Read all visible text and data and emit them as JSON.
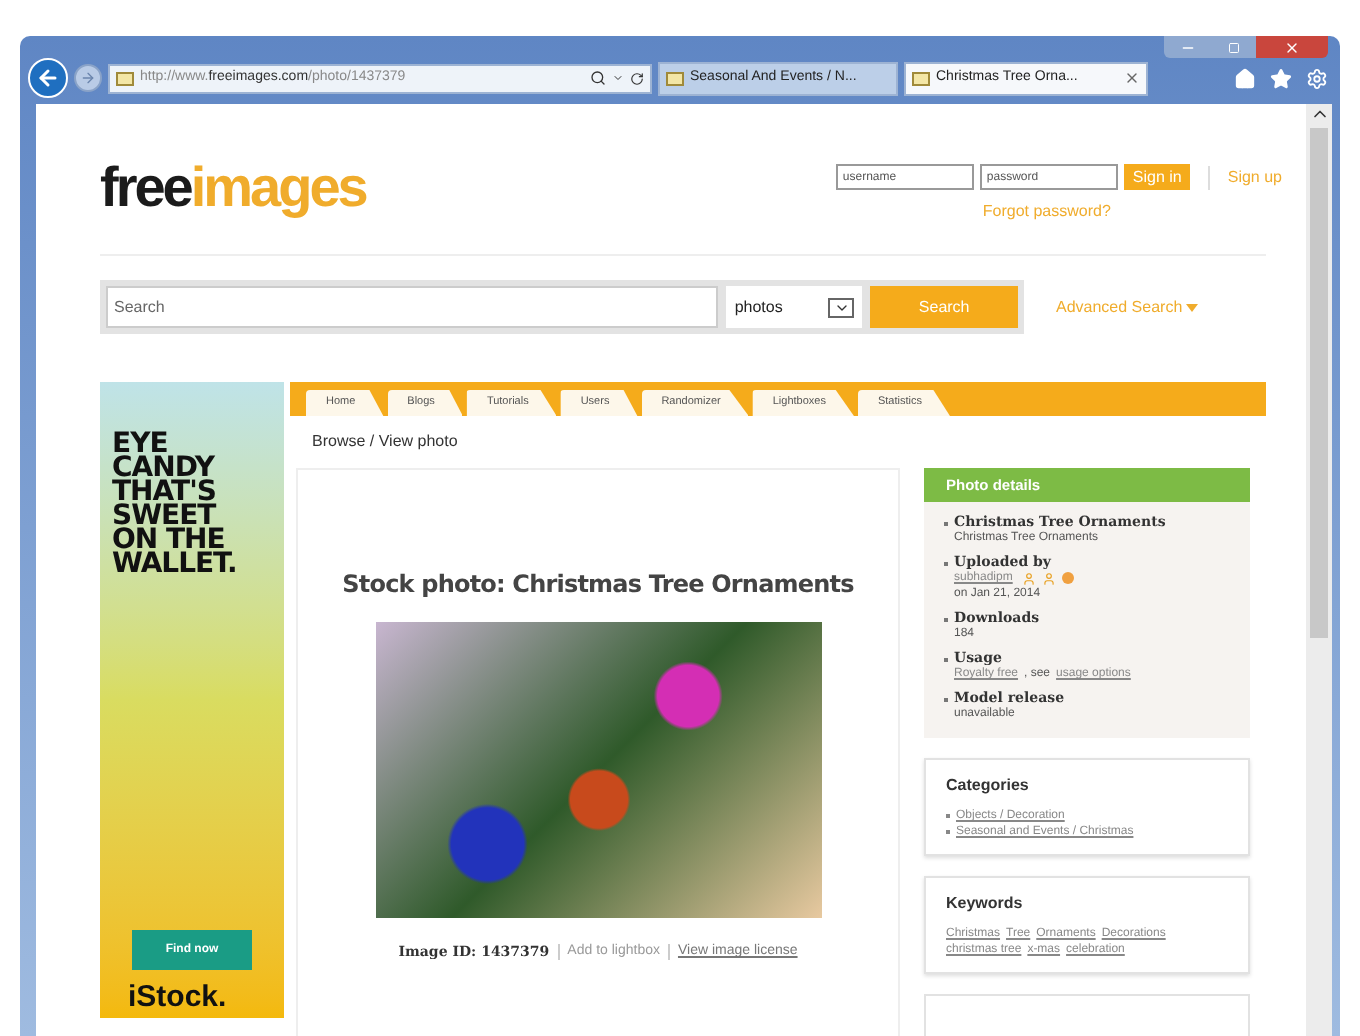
{
  "browser": {
    "address": {
      "prefix": "http://www.",
      "domain": "freeimages.com",
      "path": "/photo/1437379"
    },
    "tabs": [
      {
        "label": "Seasonal And Events / N...",
        "selected": false
      },
      {
        "label": "Christmas Tree Orna...",
        "selected": true
      }
    ]
  },
  "header": {
    "logo": {
      "first": "free",
      "second": "images"
    },
    "login": {
      "username_placeholder": "username",
      "password_placeholder": "password",
      "sign_in": "Sign in",
      "sign_up": "Sign up",
      "forgot": "Forgot password?"
    }
  },
  "search": {
    "placeholder": "Search",
    "type": "photos",
    "button": "Search",
    "advanced": "Advanced Search"
  },
  "ad": {
    "headline": [
      "EYE",
      "CANDY",
      "THAT'S",
      "SWEET",
      "ON THE",
      "WALLET."
    ],
    "button": "Find now",
    "brand": "iStock."
  },
  "nav": [
    "Home",
    "Blogs",
    "Tutorials",
    "Users",
    "Randomizer",
    "Lightboxes",
    "Statistics"
  ],
  "breadcrumb": "Browse / View photo",
  "photo": {
    "title": "Stock photo: Christmas Tree Ornaments",
    "image_id": "Image ID: 1437379",
    "actions": [
      {
        "label": "Add to lightbox",
        "kind": "plain"
      },
      {
        "label": "View image license",
        "kind": "link"
      }
    ]
  },
  "details": {
    "title": "Photo details",
    "items": [
      {
        "title": "Christmas Tree Ornaments",
        "kind": "plain",
        "lines": [
          [
            {
              "text": "Christmas Tree Ornaments",
              "kind": "plain"
            }
          ]
        ]
      },
      {
        "title": "Uploaded by",
        "kind": "uploader",
        "lines": [
          [
            {
              "text": "subhadipm",
              "kind": "link"
            }
          ],
          [
            {
              "text": "on Jan 21, 2014",
              "kind": "plain"
            }
          ]
        ]
      },
      {
        "title": "Downloads",
        "kind": "plain",
        "lines": [
          [
            {
              "text": "184",
              "kind": "plain"
            }
          ]
        ]
      },
      {
        "title": "Usage",
        "kind": "plain",
        "lines": [
          [
            {
              "text": "Royalty free",
              "kind": "link"
            },
            {
              "text": ", see",
              "kind": "plain"
            },
            {
              "text": "usage options",
              "kind": "link"
            }
          ]
        ]
      },
      {
        "title": "Model release",
        "kind": "plain",
        "lines": [
          [
            {
              "text": "unavailable",
              "kind": "plain"
            }
          ]
        ]
      }
    ]
  },
  "categories": {
    "title": "Categories",
    "items": [
      "Objects / Decoration",
      "Seasonal and Events / Christmas"
    ]
  },
  "keywords": {
    "title": "Keywords",
    "items": [
      "Christmas",
      "Tree",
      "Ornaments",
      "Decorations",
      "christmas tree",
      "x-mas",
      "celebration"
    ]
  }
}
